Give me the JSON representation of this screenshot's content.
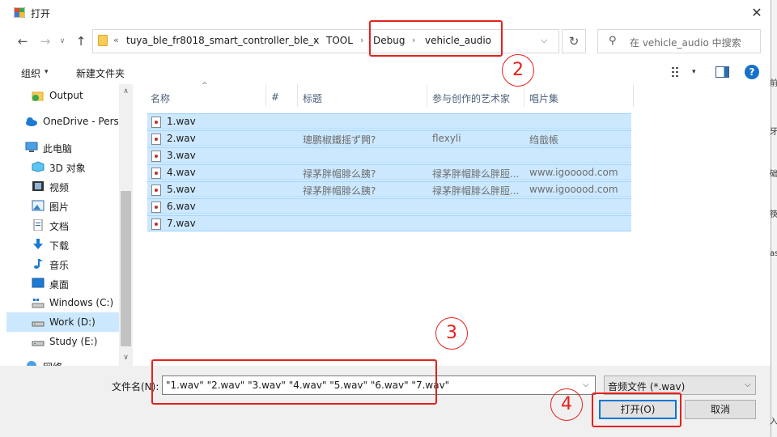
{
  "window": {
    "title": "打开",
    "close_glyph": "✕"
  },
  "navigation": {
    "back_glyph": "←",
    "forward_glyph": "→",
    "recent_glyph": "∨",
    "up_glyph": "↑",
    "refresh_glyph": "↻",
    "address_overflow": "«",
    "breadcrumbs": [
      "tuya_ble_fr8018_smart_controller_ble_x",
      "TOOL",
      "Debug",
      "vehicle_audio"
    ],
    "separator": "›",
    "dropdown_glyph": "⌵",
    "search_placeholder": "在 vehicle_audio 中搜索",
    "search_icon_glyph": "⚲"
  },
  "toolbar": {
    "organize_label": "组织",
    "new_folder_label": "新建文件夹",
    "caret": "▾",
    "help_glyph": "?"
  },
  "nav_pane": {
    "items": [
      {
        "label": "Output",
        "icon": "folder-sync-icon",
        "indent": 2
      },
      {
        "label": "OneDrive - Perso",
        "icon": "onedrive-cloud-icon",
        "indent": 1
      },
      {
        "label": "此电脑",
        "icon": "this-pc-icon",
        "indent": 1
      },
      {
        "label": "3D 对象",
        "icon": "3d-objects-icon",
        "indent": 2
      },
      {
        "label": "视频",
        "icon": "videos-icon",
        "indent": 2
      },
      {
        "label": "图片",
        "icon": "pictures-icon",
        "indent": 2
      },
      {
        "label": "文档",
        "icon": "documents-icon",
        "indent": 2
      },
      {
        "label": "下载",
        "icon": "downloads-icon",
        "indent": 2
      },
      {
        "label": "音乐",
        "icon": "music-icon",
        "indent": 2
      },
      {
        "label": "桌面",
        "icon": "desktop-icon",
        "indent": 2
      },
      {
        "label": "Windows (C:)",
        "icon": "windows-drive-icon",
        "indent": 2
      },
      {
        "label": "Work (D:)",
        "icon": "drive-icon",
        "indent": 2,
        "selected": true
      },
      {
        "label": "Study (E:)",
        "icon": "drive-icon",
        "indent": 2
      },
      {
        "label": "网络",
        "icon": "network-icon",
        "indent": 1
      }
    ],
    "scroll_up_glyph": "∧",
    "scroll_down_glyph": "∨"
  },
  "file_list": {
    "columns": [
      "名称",
      "#",
      "标题",
      "参与创作的艺术家",
      "唱片集"
    ],
    "sort_glyph": "^",
    "rows": [
      {
        "name": "1.wav",
        "num": "",
        "title": "",
        "artist": "",
        "album": ""
      },
      {
        "name": "2.wav",
        "num": "",
        "title": "璁鹏椒鐵摇ず闁?",
        "artist": "flexyli",
        "album": "绉戠帳"
      },
      {
        "name": "3.wav",
        "num": "",
        "title": "",
        "artist": "",
        "album": ""
      },
      {
        "name": "4.wav",
        "num": "",
        "title": "禄茅胖帽腓么胰?",
        "artist": "禄茅胖帽腓么胖脰...",
        "album": "www.igooood.com"
      },
      {
        "name": "5.wav",
        "num": "",
        "title": "禄茅胖帽腓么胰?",
        "artist": "禄茅胖帽腓么胖脰...",
        "album": "www.igooood.com"
      },
      {
        "name": "6.wav",
        "num": "",
        "title": "",
        "artist": "",
        "album": ""
      },
      {
        "name": "7.wav",
        "num": "",
        "title": "",
        "artist": "",
        "album": ""
      }
    ]
  },
  "bottom": {
    "filename_label": "文件名(N):",
    "filename_value": "\"1.wav\" \"2.wav\" \"3.wav\" \"4.wav\" \"5.wav\" \"6.wav\" \"7.wav\"",
    "filetype_value": "音频文件 (*.wav)",
    "open_label": "打开(O)",
    "cancel_label": "取消",
    "caret": "⌵"
  },
  "annotations": {
    "step2": "2",
    "step3": "3",
    "step4": "4",
    "color": "#e5211d"
  },
  "background_strip": [
    "前",
    "牙",
    "础",
    "筷",
    "ask",
    "入"
  ]
}
